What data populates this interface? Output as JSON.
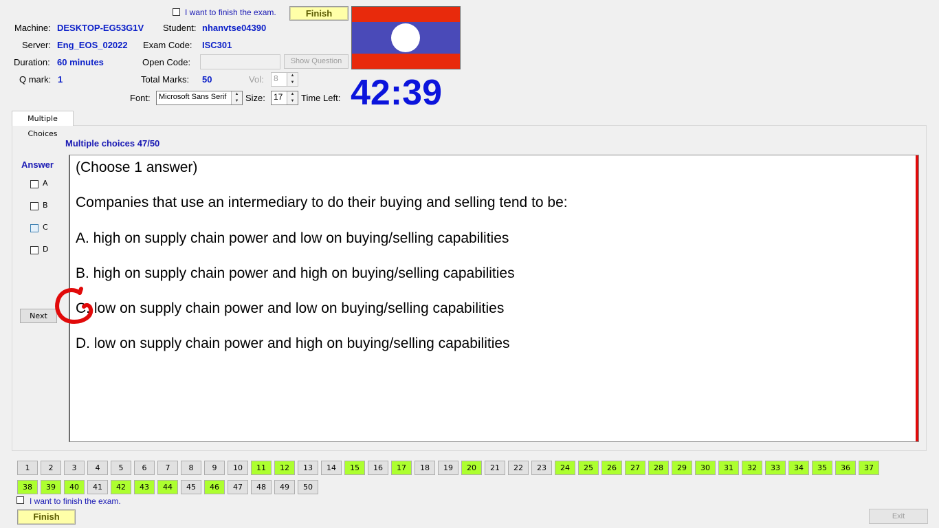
{
  "top": {
    "finish_check_label": "I want to finish the exam.",
    "finish_button": "Finish",
    "machine_label": "Machine:",
    "machine_value": "DESKTOP-EG53G1V",
    "student_label": "Student:",
    "student_value": "nhanvtse04390",
    "server_label": "Server:",
    "server_value": "Eng_EOS_02022",
    "exam_code_label": "Exam Code:",
    "exam_code_value": "ISC301",
    "duration_label": "Duration:",
    "duration_value": "60 minutes",
    "open_code_label": "Open Code:",
    "open_code_value": "",
    "show_question_button": "Show Question",
    "qmark_label": "Q mark:",
    "qmark_value": "1",
    "total_marks_label": "Total Marks:",
    "total_marks_value": "50",
    "vol_label": "Vol:",
    "vol_value": "8",
    "font_label": "Font:",
    "font_value": "Microsoft Sans Serif",
    "size_label": "Size:",
    "size_value": "17",
    "time_left_label": "Time Left:",
    "time_left_value": "42:39",
    "flag_colors": {
      "red": "#e82a0c",
      "blue": "#4a4ab8",
      "white": "#ffffff"
    }
  },
  "tab": {
    "label": "Multiple Choices"
  },
  "question": {
    "header": "Multiple choices 47/50",
    "answer_label": "Answer",
    "options": [
      "A",
      "B",
      "C",
      "D"
    ],
    "next_button": "Next",
    "instruction": "(Choose 1 answer)",
    "stem": "Companies that use an intermediary to do their buying and selling tend to be:",
    "choices": [
      "A.  high on supply chain power and low on buying/selling capabilities",
      "B.  high on supply chain power and high on buying/selling capabilities",
      "C.  low on supply chain power and low on buying/selling capabilities",
      "D.  low on supply chain power and high on buying/selling capabilities"
    ]
  },
  "nav": {
    "questions": [
      {
        "n": "1",
        "done": false
      },
      {
        "n": "2",
        "done": false
      },
      {
        "n": "3",
        "done": false
      },
      {
        "n": "4",
        "done": false
      },
      {
        "n": "5",
        "done": false
      },
      {
        "n": "6",
        "done": false
      },
      {
        "n": "7",
        "done": false
      },
      {
        "n": "8",
        "done": false
      },
      {
        "n": "9",
        "done": false
      },
      {
        "n": "10",
        "done": false
      },
      {
        "n": "11",
        "done": true
      },
      {
        "n": "12",
        "done": true
      },
      {
        "n": "13",
        "done": false
      },
      {
        "n": "14",
        "done": false
      },
      {
        "n": "15",
        "done": true
      },
      {
        "n": "16",
        "done": false
      },
      {
        "n": "17",
        "done": true
      },
      {
        "n": "18",
        "done": false
      },
      {
        "n": "19",
        "done": false
      },
      {
        "n": "20",
        "done": true
      },
      {
        "n": "21",
        "done": false
      },
      {
        "n": "22",
        "done": false
      },
      {
        "n": "23",
        "done": false
      },
      {
        "n": "24",
        "done": true
      },
      {
        "n": "25",
        "done": true
      },
      {
        "n": "26",
        "done": true
      },
      {
        "n": "27",
        "done": true
      },
      {
        "n": "28",
        "done": true
      },
      {
        "n": "29",
        "done": true
      },
      {
        "n": "30",
        "done": true
      },
      {
        "n": "31",
        "done": true
      },
      {
        "n": "32",
        "done": true
      },
      {
        "n": "33",
        "done": true
      },
      {
        "n": "34",
        "done": true
      },
      {
        "n": "35",
        "done": true
      },
      {
        "n": "36",
        "done": true
      },
      {
        "n": "37",
        "done": true
      },
      {
        "n": "38",
        "done": true
      },
      {
        "n": "39",
        "done": true
      },
      {
        "n": "40",
        "done": true
      },
      {
        "n": "41",
        "done": false
      },
      {
        "n": "42",
        "done": true
      },
      {
        "n": "43",
        "done": true
      },
      {
        "n": "44",
        "done": true
      },
      {
        "n": "45",
        "done": false
      },
      {
        "n": "46",
        "done": true
      },
      {
        "n": "47",
        "done": false
      },
      {
        "n": "48",
        "done": false
      },
      {
        "n": "49",
        "done": false
      },
      {
        "n": "50",
        "done": false
      }
    ]
  },
  "bottom": {
    "finish_check_label": "I want to finish the exam.",
    "finish_button": "Finish",
    "exit_button": "Exit"
  }
}
